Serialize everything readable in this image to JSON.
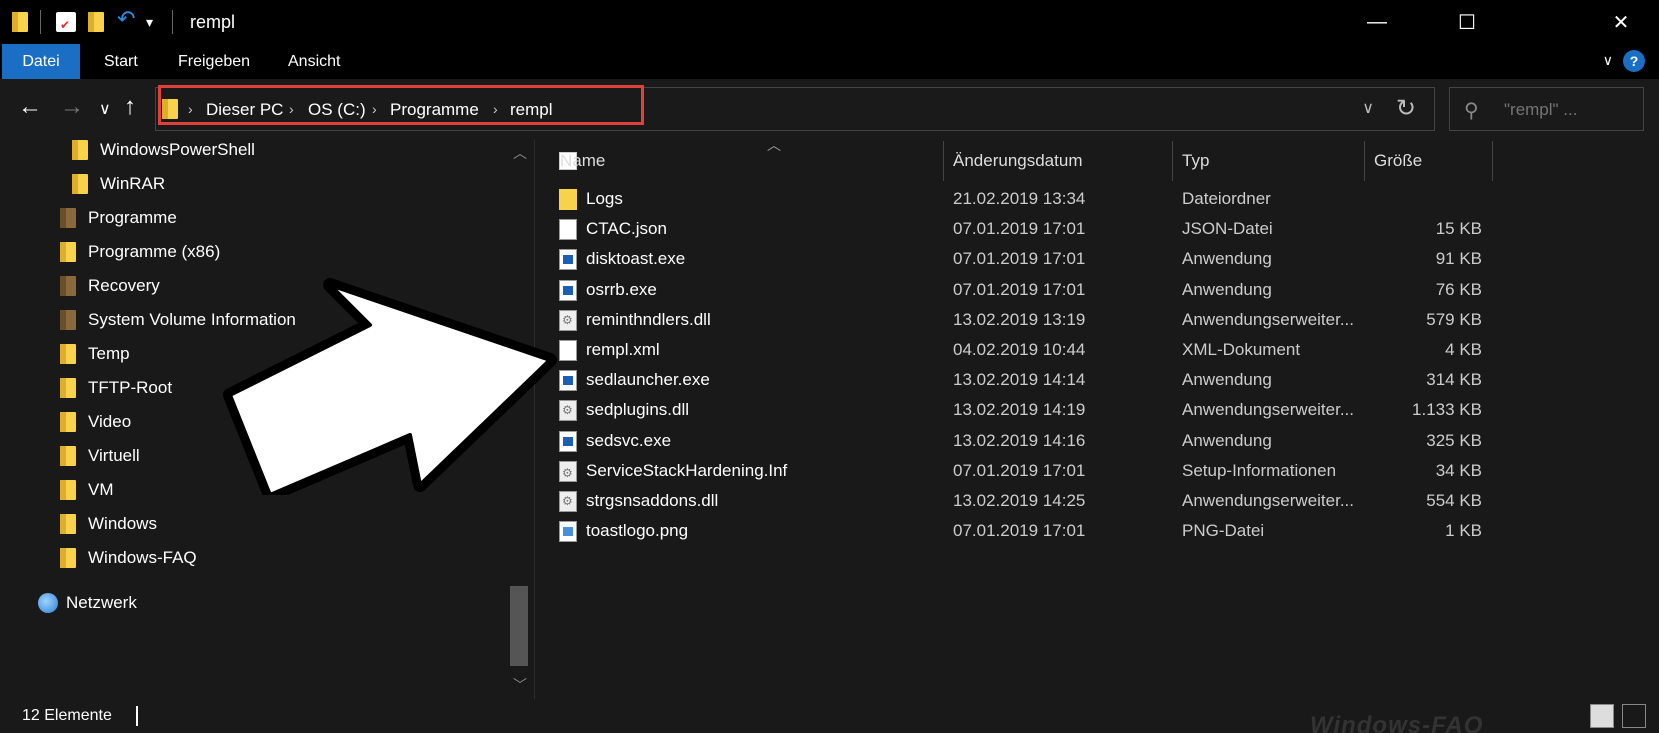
{
  "window": {
    "title": "rempl",
    "minimize_glyph": "—",
    "maximize_glyph": "☐",
    "close_glyph": "✕"
  },
  "quick_access": {
    "undo_glyph": "↶",
    "dropdown_glyph": "▾"
  },
  "ribbon": {
    "tabs": [
      "Datei",
      "Start",
      "Freigeben",
      "Ansicht"
    ],
    "active_tab": "Datei",
    "collapse_glyph": "∨",
    "help_glyph": "?"
  },
  "nav_buttons": {
    "back": "←",
    "forward": "→",
    "recent": "∨",
    "up": "↑"
  },
  "address": {
    "breadcrumbs": [
      "Dieser PC",
      "OS (C:)",
      "Programme",
      "rempl"
    ],
    "separator": "›",
    "dropdown_glyph": "∨",
    "refresh_glyph": "↻"
  },
  "search": {
    "placeholder": "\"rempl\" ...",
    "icon": "search-icon"
  },
  "nav_pane": {
    "items": [
      {
        "label": "WindowsPowerShell",
        "icon": "folder"
      },
      {
        "label": "WinRAR",
        "icon": "folder"
      },
      {
        "label": "Programme",
        "icon": "folder-shortcut"
      },
      {
        "label": "Programme (x86)",
        "icon": "folder"
      },
      {
        "label": "Recovery",
        "icon": "folder-hidden"
      },
      {
        "label": "System Volume Information",
        "icon": "folder-hidden"
      },
      {
        "label": "Temp",
        "icon": "folder"
      },
      {
        "label": "TFTP-Root",
        "icon": "folder"
      },
      {
        "label": "Video",
        "icon": "folder"
      },
      {
        "label": "Virtuell",
        "icon": "folder"
      },
      {
        "label": "VM",
        "icon": "folder"
      },
      {
        "label": "Windows",
        "icon": "folder"
      },
      {
        "label": "Windows-FAQ",
        "icon": "folder"
      },
      {
        "label": "Netzwerk",
        "icon": "network"
      }
    ]
  },
  "columns": {
    "name": "Name",
    "date": "Änderungsdatum",
    "type": "Typ",
    "size": "Größe"
  },
  "files": [
    {
      "name": "Logs",
      "date": "21.02.2019 13:34",
      "type": "Dateiordner",
      "size": "",
      "icon": "folder"
    },
    {
      "name": "CTAC.json",
      "date": "07.01.2019 17:01",
      "type": "JSON-Datei",
      "size": "15 KB",
      "icon": "doc"
    },
    {
      "name": "disktoast.exe",
      "date": "07.01.2019 17:01",
      "type": "Anwendung",
      "size": "91 KB",
      "icon": "exe"
    },
    {
      "name": "osrrb.exe",
      "date": "07.01.2019 17:01",
      "type": "Anwendung",
      "size": "76 KB",
      "icon": "exe"
    },
    {
      "name": "reminthndlers.dll",
      "date": "13.02.2019 13:19",
      "type": "Anwendungserweiter...",
      "size": "579 KB",
      "icon": "dll"
    },
    {
      "name": "rempl.xml",
      "date": "04.02.2019 10:44",
      "type": "XML-Dokument",
      "size": "4 KB",
      "icon": "doc"
    },
    {
      "name": "sedlauncher.exe",
      "date": "13.02.2019 14:14",
      "type": "Anwendung",
      "size": "314 KB",
      "icon": "exe"
    },
    {
      "name": "sedplugins.dll",
      "date": "13.02.2019 14:19",
      "type": "Anwendungserweiter...",
      "size": "1.133 KB",
      "icon": "dll"
    },
    {
      "name": "sedsvc.exe",
      "date": "13.02.2019 14:16",
      "type": "Anwendung",
      "size": "325 KB",
      "icon": "exe"
    },
    {
      "name": "ServiceStackHardening.Inf",
      "date": "07.01.2019 17:01",
      "type": "Setup-Informationen",
      "size": "34 KB",
      "icon": "inf"
    },
    {
      "name": "strgsnsaddons.dll",
      "date": "13.02.2019 14:25",
      "type": "Anwendungserweiter...",
      "size": "554 KB",
      "icon": "dll"
    },
    {
      "name": "toastlogo.png",
      "date": "07.01.2019 17:01",
      "type": "PNG-Datei",
      "size": "1 KB",
      "icon": "png"
    }
  ],
  "status": {
    "count": "12 Elemente"
  },
  "watermark": "Windows-FAQ",
  "colors": {
    "accent": "#1a6fc4",
    "highlight_border": "#e0403a",
    "background": "#191919"
  }
}
